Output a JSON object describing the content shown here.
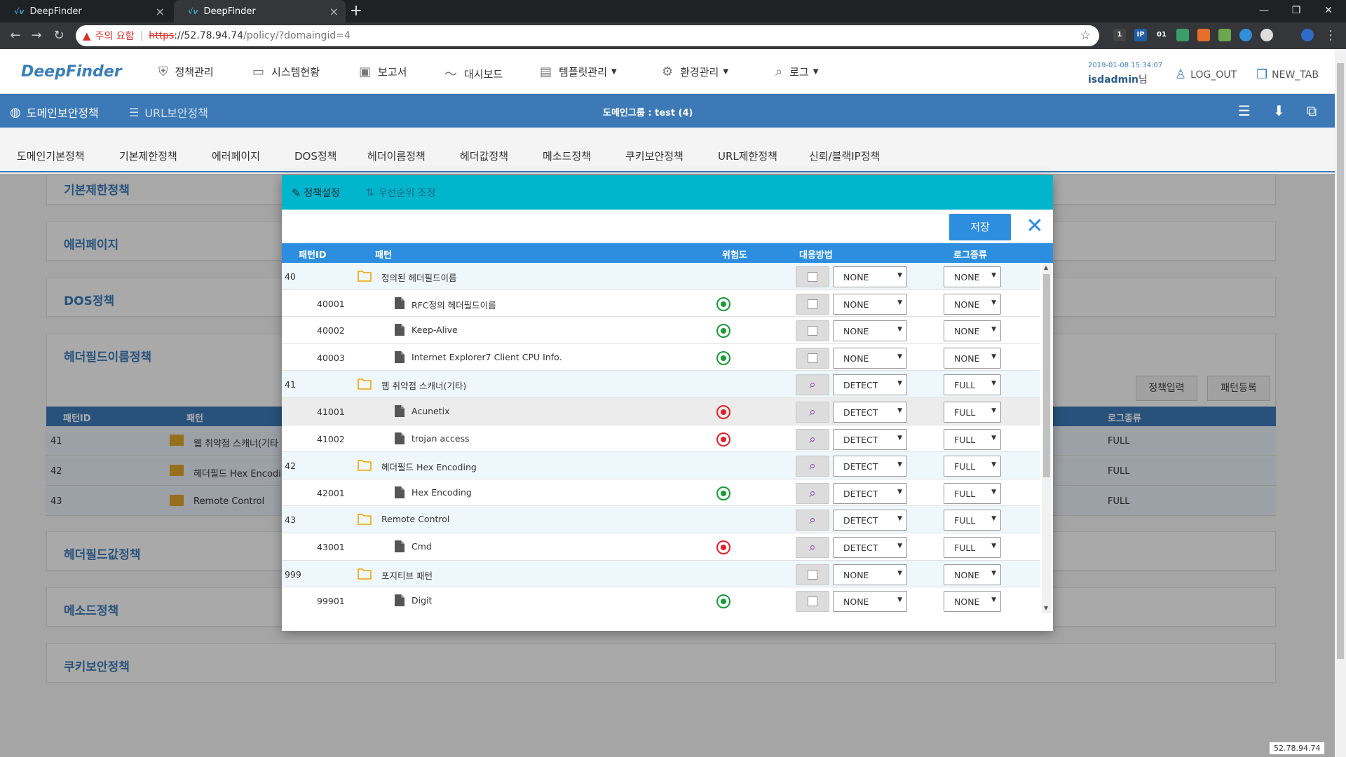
{
  "browser": {
    "tabs": [
      {
        "title": "DeepFinder",
        "active": false
      },
      {
        "title": "DeepFinder",
        "active": true
      }
    ],
    "url": {
      "warning": "주의 요함",
      "scheme": "https",
      "host": "://52.78.94.74",
      "path": "/policy/?domaingid=4"
    },
    "extensions": [
      "1",
      "IP",
      "01"
    ]
  },
  "header": {
    "logo": "DeepFinder",
    "menu": [
      {
        "label": "정책관리",
        "icon": "shield-icon"
      },
      {
        "label": "시스템현황",
        "icon": "monitor-icon"
      },
      {
        "label": "보고서",
        "icon": "clipboard-icon"
      },
      {
        "label": "대시보드",
        "icon": "chart-line-icon"
      },
      {
        "label": "템플릿관리",
        "icon": "template-icon"
      },
      {
        "label": "환경관리",
        "icon": "gear-icon"
      },
      {
        "label": "로그",
        "icon": "search-icon"
      }
    ],
    "datetime": "2019-01-08 15:34:07",
    "user": "isdadmin",
    "user_suffix": "님",
    "logout": "LOG_OUT",
    "newtab": "NEW_TAB"
  },
  "subheader": {
    "domain_policy": "도메인보안정책",
    "url_policy": "URL보안정책",
    "group": "도메인그룹 : test (4)"
  },
  "policy_tabs": [
    "도메인기본정책",
    "기본제한정책",
    "에러페이지",
    "DOS정책",
    "헤더이름정책",
    "헤더값정책",
    "메소드정책",
    "쿠키보안정책",
    "URL제한정책",
    "신뢰/블랙IP정책"
  ],
  "background": {
    "cards": [
      "기본제한정책",
      "에러페이지",
      "DOS정책",
      "헤더필드이름정책",
      "헤더필드값정책",
      "메소드정책",
      "쿠키보안정책"
    ],
    "buttons": {
      "policy_input": "정책입력",
      "pattern_register": "패턴등록"
    },
    "table_headers": {
      "id": "패턴ID",
      "pattern": "패턴",
      "log": "로그종류"
    },
    "rows": [
      {
        "id": "41",
        "pattern": "웹 취약점 스캐너(기타",
        "log": "FULL"
      },
      {
        "id": "42",
        "pattern": "헤더필드 Hex Encodin",
        "log": "FULL"
      },
      {
        "id": "43",
        "pattern": "Remote Control",
        "log": "FULL"
      }
    ],
    "ip_badge": "52.78.94.74"
  },
  "modal": {
    "tab_policy": "정책설정",
    "tab_priority": "우선순위 조정",
    "save": "저장",
    "columns": {
      "id": "패턴ID",
      "pattern": "패턴",
      "risk": "위험도",
      "action": "대응방법",
      "log": "로그종류"
    },
    "rows": [
      {
        "id": "40",
        "pattern": "정의된 헤더필드이름",
        "type": "folder",
        "risk": "",
        "action_icon": "checkbox",
        "action": "NONE",
        "log": "NONE"
      },
      {
        "id": "40001",
        "pattern": "RFC정의 헤더필드이름",
        "type": "file",
        "risk": "green",
        "action_icon": "checkbox",
        "action": "NONE",
        "log": "NONE"
      },
      {
        "id": "40002",
        "pattern": "Keep-Alive",
        "type": "file",
        "risk": "green",
        "action_icon": "checkbox",
        "action": "NONE",
        "log": "NONE"
      },
      {
        "id": "40003",
        "pattern": "Internet Explorer7 Client CPU Info.",
        "type": "file",
        "risk": "green",
        "action_icon": "checkbox",
        "action": "NONE",
        "log": "NONE"
      },
      {
        "id": "41",
        "pattern": "웹 취약점 스캐너(기타)",
        "type": "folder",
        "risk": "",
        "action_icon": "search",
        "action": "DETECT",
        "log": "FULL"
      },
      {
        "id": "41001",
        "pattern": "Acunetix",
        "type": "file",
        "risk": "red",
        "action_icon": "search",
        "action": "DETECT",
        "log": "FULL",
        "highlight": true
      },
      {
        "id": "41002",
        "pattern": "trojan access",
        "type": "file",
        "risk": "red",
        "action_icon": "search",
        "action": "DETECT",
        "log": "FULL"
      },
      {
        "id": "42",
        "pattern": "헤더필드 Hex Encoding",
        "type": "folder",
        "risk": "",
        "action_icon": "search",
        "action": "DETECT",
        "log": "FULL"
      },
      {
        "id": "42001",
        "pattern": "Hex Encoding",
        "type": "file",
        "risk": "green",
        "action_icon": "search",
        "action": "DETECT",
        "log": "FULL"
      },
      {
        "id": "43",
        "pattern": "Remote Control",
        "type": "folder",
        "risk": "",
        "action_icon": "search",
        "action": "DETECT",
        "log": "FULL"
      },
      {
        "id": "43001",
        "pattern": "Cmd",
        "type": "file",
        "risk": "red",
        "action_icon": "search",
        "action": "DETECT",
        "log": "FULL"
      },
      {
        "id": "999",
        "pattern": "포지티브 패턴",
        "type": "folder",
        "risk": "",
        "action_icon": "checkbox",
        "action": "NONE",
        "log": "NONE"
      },
      {
        "id": "99901",
        "pattern": "Digit",
        "type": "file",
        "risk": "green",
        "action_icon": "checkbox",
        "action": "NONE",
        "log": "NONE"
      }
    ]
  },
  "colors": {
    "brand_blue": "#3c79b6",
    "modal_header": "#00b5cc",
    "table_header": "#2d8ee0",
    "risk_low": "#1a9b3a",
    "risk_high": "#e0202a"
  }
}
